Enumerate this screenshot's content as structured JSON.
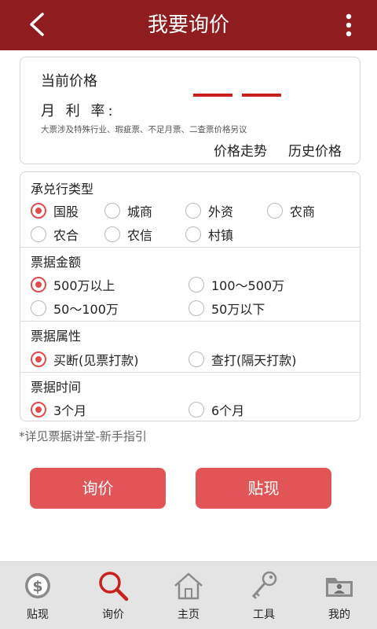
{
  "header": {
    "title": "我要询价",
    "back_icon": "back-arrow-icon",
    "more_icon": "more-vertical-icon",
    "color": "#8f1d1f"
  },
  "price_info": {
    "current_price_label": "当前价格",
    "monthly_rate_label": "月 利 率:",
    "note": "大票涉及特殊行业、瑕疵票、不足月票、二查票价格另议",
    "trend_link": "价格走势",
    "history_link": "历史价格"
  },
  "sections": {
    "bank_type": {
      "title": "承兑行类型",
      "selected": "国股",
      "options": [
        "国股",
        "城商",
        "外资",
        "农商",
        "农合",
        "农信",
        "村镇"
      ]
    },
    "amount": {
      "title": "票据金额",
      "selected": "500万以上",
      "options": [
        "500万以上",
        "100～500万",
        "50～100万",
        "50万以下"
      ]
    },
    "attribute": {
      "title": "票据属性",
      "selected": "买断(见票打款)",
      "options": [
        "买断(见票打款)",
        "查打(隔天打款)"
      ]
    },
    "time": {
      "title": "票据时间",
      "selected": "3个月",
      "options": [
        "3个月",
        "6个月"
      ]
    }
  },
  "guide_text": "*详见票据讲堂-新手指引",
  "buttons": {
    "inquire": "询价",
    "discount": "贴现",
    "color": "#e15557"
  },
  "tabbar": {
    "items": [
      {
        "label": "贴现",
        "icon": "dollar-coin-icon",
        "active": false
      },
      {
        "label": "询价",
        "icon": "search-icon",
        "active": true
      },
      {
        "label": "主页",
        "icon": "home-icon",
        "active": false
      },
      {
        "label": "工具",
        "icon": "key-icon",
        "active": false
      },
      {
        "label": "我的",
        "icon": "profile-folder-icon",
        "active": false
      }
    ]
  },
  "colors": {
    "accent": "#c8201d",
    "radio_selected": "#e04b4b"
  }
}
